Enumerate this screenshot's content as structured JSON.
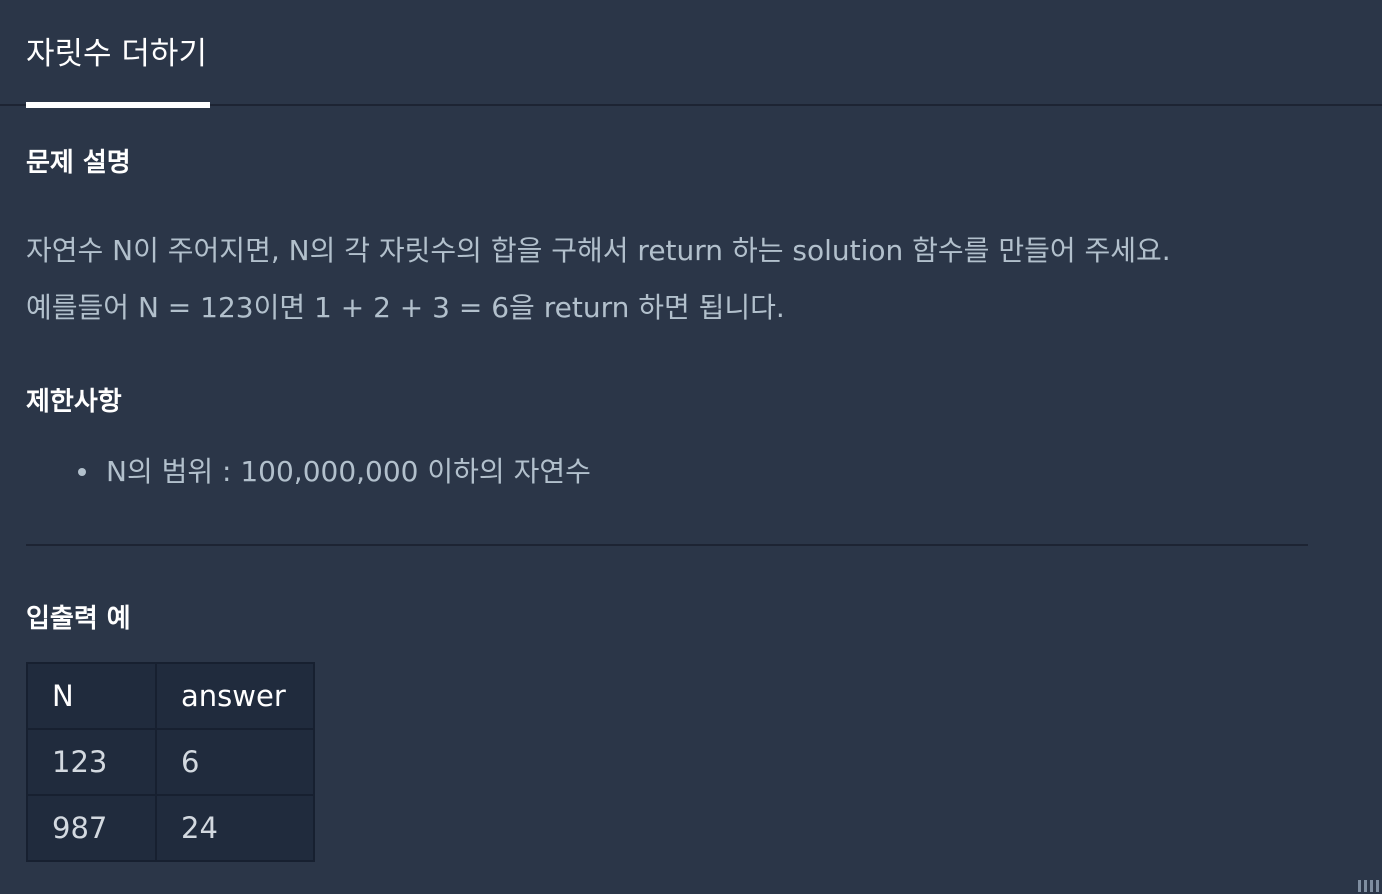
{
  "tab": {
    "title": "자릿수 더하기"
  },
  "description": {
    "heading": "문제 설명",
    "lines": [
      "자연수 N이 주어지면, N의 각 자릿수의 합을 구해서 return 하는 solution 함수를 만들어 주세요.",
      "예를들어 N = 123이면 1 + 2 + 3 = 6을 return 하면 됩니다."
    ]
  },
  "limits": {
    "heading": "제한사항",
    "items": [
      "N의 범위 : 100,000,000 이하의 자연수"
    ]
  },
  "examples": {
    "heading": "입출력 예",
    "columns": [
      "N",
      "answer"
    ],
    "rows": [
      [
        "123",
        "6"
      ],
      [
        "987",
        "24"
      ]
    ]
  },
  "colors": {
    "background": "#2b3648",
    "heading": "#ffffff",
    "body_text": "#b2c0cc",
    "table_background": "#202b3d",
    "border": "#172030"
  },
  "icons": {
    "resize_grip": "resize-grip-icon"
  }
}
